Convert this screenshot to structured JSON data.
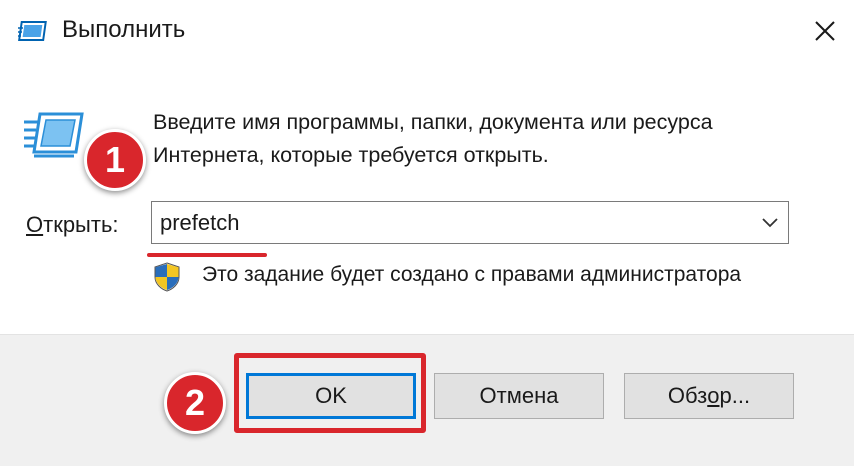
{
  "window": {
    "title": "Выполнить",
    "title_icon": "run-dialog-icon",
    "close_icon": "close-icon"
  },
  "content": {
    "description_line1": "Введите имя программы, папки, документа или ресурса",
    "description_line2": "Интернета, которые требуется открыть.",
    "open_label_access_key": "О",
    "open_label_rest": "ткрыть:",
    "input_value": "prefetch",
    "dropdown_icon": "chevron-down-icon",
    "admin_notice": "Это задание будет создано с правами администратора",
    "admin_icon": "uac-shield-icon"
  },
  "buttons": {
    "ok_label": "OK",
    "cancel_label": "Отмена",
    "browse_label_before_key": "Обз",
    "browse_label_access_key": "о",
    "browse_label_after_key": "р..."
  },
  "annotations": {
    "step1": "1",
    "step2": "2",
    "color": "#d9262c"
  },
  "colors": {
    "accent": "#0078d7",
    "footer_bg": "#f0f0f0",
    "annotation_red": "#d9262c"
  }
}
